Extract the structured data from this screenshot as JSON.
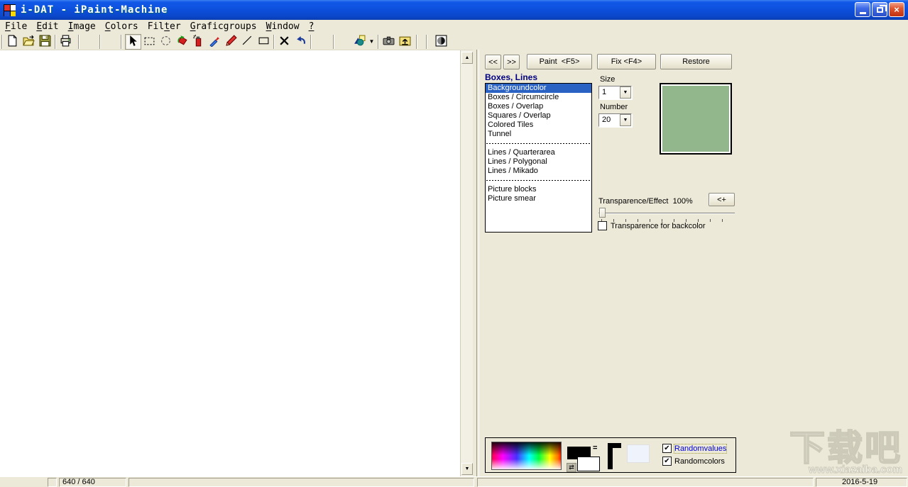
{
  "window": {
    "title": "i-DAT - iPaint-Machine"
  },
  "menu": {
    "items": [
      {
        "pre": "",
        "key": "F",
        "post": "ile"
      },
      {
        "pre": "",
        "key": "E",
        "post": "dit"
      },
      {
        "pre": "",
        "key": "I",
        "post": "mage"
      },
      {
        "pre": "",
        "key": "C",
        "post": "olors"
      },
      {
        "pre": "Fil",
        "key": "t",
        "post": "er"
      },
      {
        "pre": "",
        "key": "G",
        "post": "raficgroups"
      },
      {
        "pre": "",
        "key": "W",
        "post": "indow"
      },
      {
        "pre": "",
        "key": "?",
        "post": ""
      }
    ]
  },
  "toolbar": {
    "buttons": [
      "new-document",
      "open-folder",
      "save",
      "print",
      "select-arrow",
      "rect-select",
      "ellipse-select",
      "fill-rotate",
      "spray-can",
      "eyedropper",
      "pencil",
      "line",
      "rectangle",
      "delete-x",
      "undo",
      "shapes-picker",
      "camera-snapshot",
      "folder-up",
      "contrast-gradient"
    ]
  },
  "panel": {
    "nav": {
      "back": "<<",
      "forward": ">>",
      "paint": "Paint  <F5>",
      "fix": "Fix <F4>",
      "restore": "Restore"
    },
    "group_title": "Boxes, Lines",
    "list": {
      "items": [
        {
          "label": "Backgroundcolor",
          "selected": true
        },
        {
          "label": "Boxes / Circumcircle"
        },
        {
          "label": "Boxes / Overlap"
        },
        {
          "label": "Squares / Overlap"
        },
        {
          "label": "Colored Tiles"
        },
        {
          "label": "Tunnel"
        },
        {
          "separator": true
        },
        {
          "label": "Lines / Quarterarea"
        },
        {
          "label": "Lines / Polygonal"
        },
        {
          "label": "Lines / Mikado"
        },
        {
          "separator": true
        },
        {
          "label": "Picture blocks"
        },
        {
          "label": "Picture smear"
        }
      ]
    },
    "size": {
      "label": "Size",
      "value": "1"
    },
    "number": {
      "label": "Number",
      "value": "20"
    },
    "preview_color": "#92B78C",
    "transparence": {
      "label": "Transparence/Effect",
      "value": "100%",
      "button": "<+",
      "checkbox_label": "Transparence for backcolor",
      "checked": false
    },
    "random": {
      "values_label": "Randomvalues",
      "colors_label": "Randomcolors",
      "values_checked": true,
      "colors_checked": true
    },
    "check_glyph": "✔"
  },
  "statusbar": {
    "size_info": "640 / 640",
    "date": "2016-5-19"
  },
  "watermark": {
    "text": "下载吧",
    "url": "www.xiazaiba.com"
  },
  "colors": {
    "titlebar_blue": "#0D50DE",
    "window_beige": "#ECE9D8",
    "selection_blue": "#2A62C4",
    "header_navy": "#000080",
    "preview_green": "#92B78C"
  }
}
